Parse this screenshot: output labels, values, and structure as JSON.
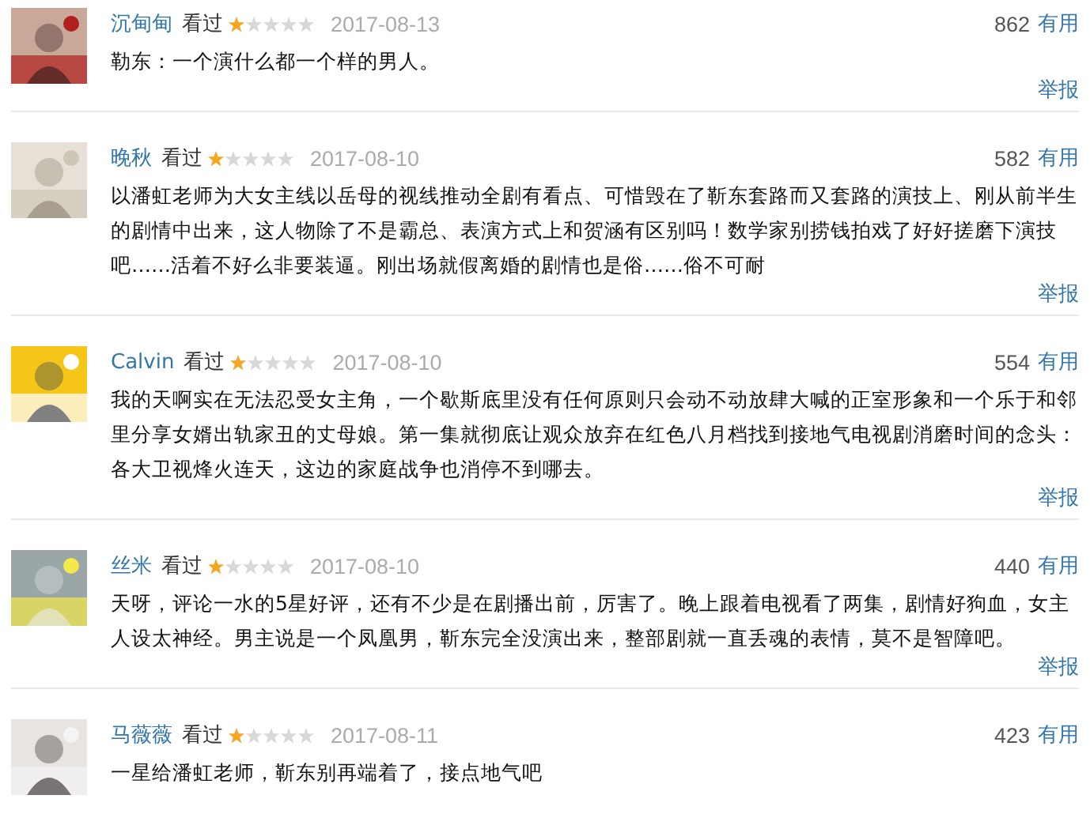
{
  "reviews": [
    {
      "user": "沉甸甸",
      "status": "看过",
      "stars": 1,
      "date": "2017-08-13",
      "votes": "862",
      "vote_label": "有用",
      "text": "勒东：一个演什么都一个样的男人。",
      "report": "举报"
    },
    {
      "user": "晚秋",
      "status": "看过",
      "stars": 1,
      "date": "2017-08-10",
      "votes": "582",
      "vote_label": "有用",
      "text": "以潘虹老师为大女主线以岳母的视线推动全剧有看点、可惜毁在了靳东套路而又套路的演技上、刚从前半生的剧情中出来，这人物除了不是霸总、表演方式上和贺涵有区别吗！数学家别捞钱拍戏了好好搓磨下演技吧……活着不好么非要装逼。刚出场就假离婚的剧情也是俗……俗不可耐",
      "report": "举报"
    },
    {
      "user": "Calvin",
      "status": "看过",
      "stars": 1,
      "date": "2017-08-10",
      "votes": "554",
      "vote_label": "有用",
      "text": "我的天啊实在无法忍受女主角，一个歇斯底里没有任何原则只会动不动放肆大喊的正室形象和一个乐于和邻里分享女婿出轨家丑的丈母娘。第一集就彻底让观众放弃在红色八月档找到接地气电视剧消磨时间的念头：各大卫视烽火连天，这边的家庭战争也消停不到哪去。",
      "report": "举报"
    },
    {
      "user": "丝米",
      "status": "看过",
      "stars": 1,
      "date": "2017-08-10",
      "votes": "440",
      "vote_label": "有用",
      "text": "天呀，评论一水的5星好评，还有不少是在剧播出前，厉害了。晚上跟着电视看了两集，剧情好狗血，女主人设太神经。男主说是一个凤凰男，靳东完全没演出来，整部剧就一直丢魂的表情，莫不是智障吧。",
      "report": "举报"
    },
    {
      "user": "马薇薇",
      "status": "看过",
      "stars": 1,
      "date": "2017-08-11",
      "votes": "423",
      "vote_label": "有用",
      "text": "一星给潘虹老师，靳东别再端着了，接点地气吧"
    }
  ]
}
